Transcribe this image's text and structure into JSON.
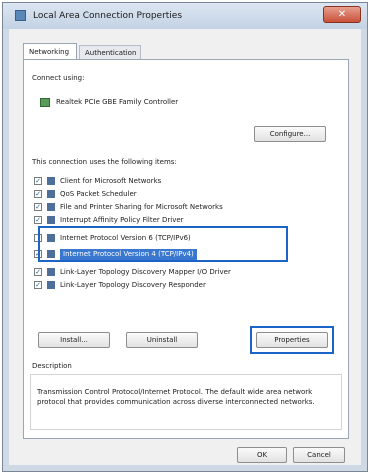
{
  "window": {
    "title": "Local Area Connection Properties",
    "close_label": "✕"
  },
  "tabs": [
    {
      "label": "Networking"
    },
    {
      "label": "Authentication"
    }
  ],
  "connect_using": {
    "label": "Connect using:",
    "adapter": "Realtek PCIe GBE Family Controller",
    "configure_label": "Configure..."
  },
  "items_heading": "This connection uses the following items:",
  "items": [
    {
      "label": "Client for Microsoft Networks",
      "checked": true
    },
    {
      "label": "QoS Packet Scheduler",
      "checked": true
    },
    {
      "label": "File and Printer Sharing for Microsoft Networks",
      "checked": true
    },
    {
      "label": "Interrupt Affinity Policy Filter Driver",
      "checked": true
    },
    {
      "label": "Internet Protocol Version 6 (TCP/IPv6)",
      "checked": false
    },
    {
      "label": "Internet Protocol Version 4 (TCP/IPv4)",
      "checked": true,
      "selected": true
    },
    {
      "label": "Link-Layer Topology Discovery Mapper I/O Driver",
      "checked": true
    },
    {
      "label": "Link-Layer Topology Discovery Responder",
      "checked": true
    }
  ],
  "item_buttons": {
    "install": "Install...",
    "uninstall": "Uninstall",
    "properties": "Properties"
  },
  "description": {
    "label": "Description",
    "text": "Transmission Control Protocol/Internet Protocol. The default wide area network protocol that provides communication across diverse interconnected networks."
  },
  "footer": {
    "ok": "OK",
    "cancel": "Cancel"
  },
  "colors": {
    "selection": "#3a78d0",
    "callout": "#1c64c8"
  }
}
